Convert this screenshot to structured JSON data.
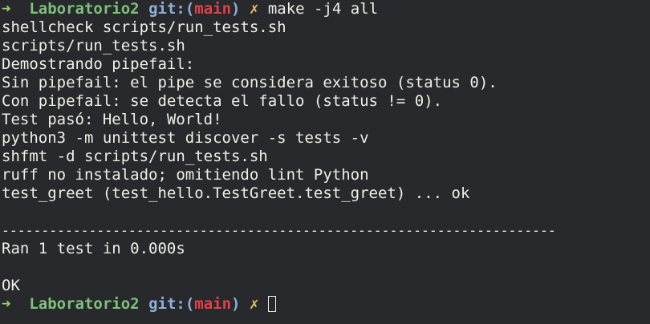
{
  "prompt1": {
    "arrow": "➜",
    "dir": "Laboratorio2",
    "git": "git:(",
    "branch": "main",
    "git_close": ")",
    "dirty": "✗",
    "command": "make -j4 all"
  },
  "output": [
    "shellcheck scripts/run_tests.sh",
    "scripts/run_tests.sh",
    "Demostrando pipefail:",
    "Sin pipefail: el pipe se considera exitoso (status 0).",
    "Con pipefail: se detecta el fallo (status != 0).",
    "Test pasó: Hello, World!",
    "python3 -m unittest discover -s tests -v",
    "shfmt -d scripts/run_tests.sh",
    "ruff no instalado; omitiendo lint Python",
    "test_greet (test_hello.TestGreet.test_greet) ... ok",
    "",
    "----------------------------------------------------------------------",
    "Ran 1 test in 0.000s",
    "",
    "OK"
  ],
  "prompt2": {
    "arrow": "➜",
    "dir": "Laboratorio2",
    "git": "git:(",
    "branch": "main",
    "git_close": ")",
    "dirty": "✗"
  },
  "colors": {
    "background": "#28292d",
    "foreground": "#f0efe4",
    "prompt_arrow": "#9ed26b",
    "prompt_dir": "#7ec27a",
    "git_label": "#8fb0d8",
    "branch": "#e0414a",
    "dirty_mark": "#e8c26a"
  }
}
